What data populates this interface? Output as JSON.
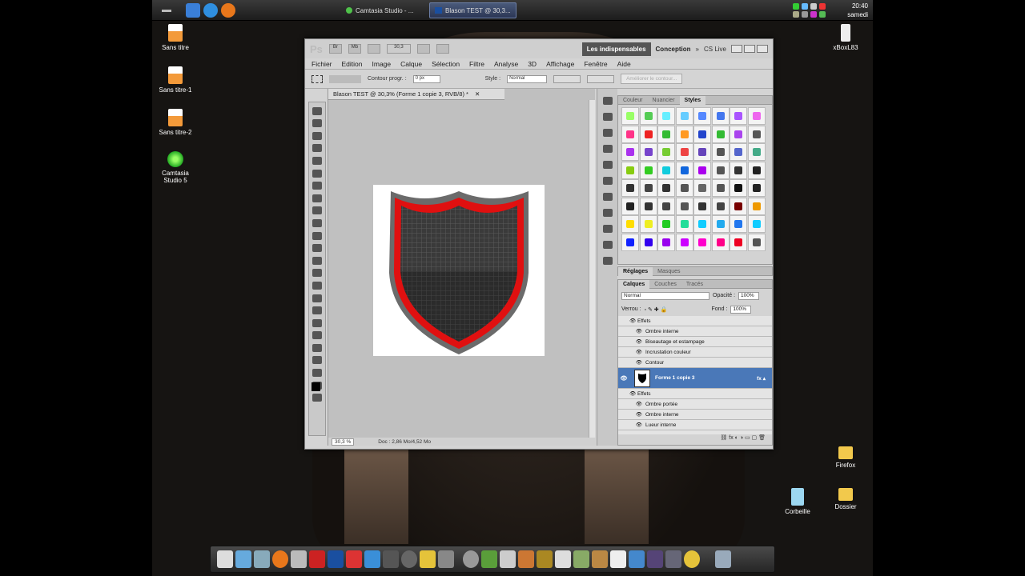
{
  "taskbar": {
    "windows": [
      {
        "label": "Camtasia Studio - ..."
      },
      {
        "label": "Blason TEST @ 30,3..."
      }
    ],
    "clock": {
      "time": "20:40",
      "day": "samedi"
    }
  },
  "desktop": {
    "left_icons": [
      {
        "label": "Sans titre"
      },
      {
        "label": "Sans titre-1"
      },
      {
        "label": "Sans titre-2"
      },
      {
        "label": "Camtasia Studio 5"
      }
    ],
    "right_icons": [
      {
        "label": "xBoxL83"
      },
      {
        "label": "Firefox"
      },
      {
        "label": "Corbeille"
      },
      {
        "label": "Dossier"
      }
    ]
  },
  "photoshop": {
    "logo": "Ps",
    "zoom_field": "30,3",
    "workspaces": [
      "Les indispensables",
      "Conception"
    ],
    "cslive": "CS Live",
    "menu": [
      "Fichier",
      "Edition",
      "Image",
      "Calque",
      "Sélection",
      "Filtre",
      "Analyse",
      "3D",
      "Affichage",
      "Fenêtre",
      "Aide"
    ],
    "options": {
      "contour_label": "Contour progr. :",
      "contour_value": "0 px",
      "style_label": "Style :",
      "style_value": "Normal",
      "refine_button": "Améliorer le contour..."
    },
    "doc_tab": "Blason TEST @ 30,3% (Forme 1 copie 3, RVB/8) *",
    "status": {
      "zoom": "30,3 %",
      "doc": "Doc : 2,86 Mo/4,52 Mo"
    },
    "styles_panel": {
      "tabs": [
        "Couleur",
        "Nuancier",
        "Styles"
      ]
    },
    "adjust_panel": {
      "tabs": [
        "Réglages",
        "Masques"
      ]
    },
    "layers_panel": {
      "tabs": [
        "Calques",
        "Couches",
        "Tracés"
      ],
      "blend": "Normal",
      "opacity_label": "Opacité :",
      "opacity": "100%",
      "lock_label": "Verrou :",
      "fill_label": "Fond :",
      "fill": "100%",
      "rows": [
        {
          "text": "Effets",
          "indent": 1
        },
        {
          "text": "Ombre interne",
          "indent": 2
        },
        {
          "text": "Biseautage et estampage",
          "indent": 2
        },
        {
          "text": "Incrustation couleur",
          "indent": 2
        },
        {
          "text": "Contour",
          "indent": 2
        }
      ],
      "selected_layer": "Forme 1 copie 3",
      "rows_after": [
        {
          "text": "Effets",
          "indent": 1
        },
        {
          "text": "Ombre portée",
          "indent": 2
        },
        {
          "text": "Ombre interne",
          "indent": 2
        },
        {
          "text": "Lueur interne",
          "indent": 2
        }
      ]
    }
  },
  "colors": {
    "accent": "#4a78b8",
    "shield_red": "#e01010",
    "shield_gray": "#6b6b6b"
  }
}
